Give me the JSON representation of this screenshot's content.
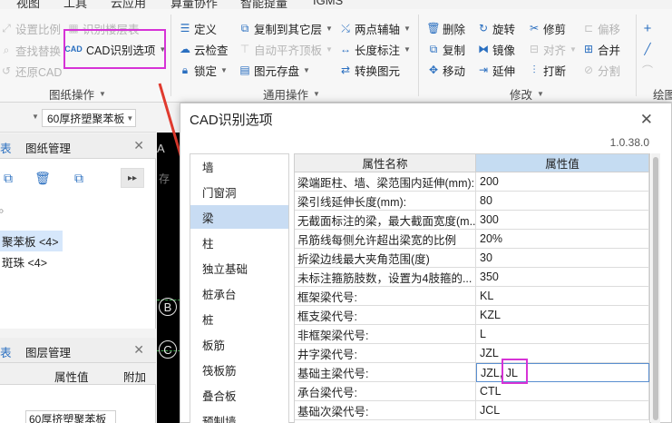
{
  "menubar": {
    "items": [
      "视图",
      "工具",
      "云应用",
      "算量协作",
      "智能提量",
      "IGMS"
    ]
  },
  "ribbon": {
    "drawing_ops": {
      "set_scale": "设置比例",
      "find_replace": "查找替换",
      "restore_cad": "还原CAD",
      "identify_floor_table": "识别楼层表",
      "cad_options": "CAD识别选项",
      "group_label": "图纸操作"
    },
    "common_ops": {
      "define": "定义",
      "cloud_check": "云检查",
      "lock": "锁定",
      "copy_to_floor": "复制到其它层",
      "auto_align": "自动平齐顶板",
      "element_save": "图元存盘",
      "two_point_axis": "两点辅轴",
      "length_dim": "长度标注",
      "convert_element": "转换图元",
      "group_label": "通用操作"
    },
    "modify_ops": {
      "delete": "删除",
      "copy": "复制",
      "move": "移动",
      "rotate": "旋转",
      "mirror": "镜像",
      "extend": "延伸",
      "trim": "修剪",
      "align": "对齐",
      "break": "打断",
      "offset": "偏移",
      "merge": "合并",
      "split": "分割",
      "group_label": "修改"
    },
    "draw_ops": {
      "group_label": "绘图"
    }
  },
  "left_panel": {
    "layer_select_value": "60厚挤塑聚苯板",
    "tabs_a": [
      "表",
      "图纸管理"
    ],
    "list_items": [
      "聚苯板 <4>",
      "斑珠 <4>"
    ],
    "tabs_b": [
      "表",
      "图层管理"
    ],
    "cols_b": [
      "属性值",
      "附加"
    ],
    "value_b": "60厚挤塑聚苯板"
  },
  "canvas": {
    "axis_labels": [
      "A",
      "B",
      "C"
    ],
    "side_text": "存"
  },
  "dialog": {
    "title": "CAD识别选项",
    "version": "1.0.38.0",
    "element_types": [
      "墙",
      "门窗洞",
      "梁",
      "柱",
      "独立基础",
      "桩承台",
      "桩",
      "板筋",
      "筏板筋",
      "叠合板",
      "预制墙"
    ],
    "selected_element": "梁",
    "grid_headers": {
      "name": "属性名称",
      "value": "属性值"
    },
    "rows": [
      {
        "name": "梁端距柱、墙、梁范围内延伸(mm):",
        "value": "200"
      },
      {
        "name": "梁引线延伸长度(mm):",
        "value": "80"
      },
      {
        "name": "无截面标注的梁，最大截面宽度(m...",
        "value": "300"
      },
      {
        "name": "吊筋线每侧允许超出梁宽的比例",
        "value": "20%"
      },
      {
        "name": "折梁边线最大夹角范围(度)",
        "value": "30"
      },
      {
        "name": "未标注箍筋肢数，设置为4肢箍的...",
        "value": "350"
      },
      {
        "name": "框架梁代号:",
        "value": "KL"
      },
      {
        "name": "框支梁代号:",
        "value": "KZL"
      },
      {
        "name": "非框架梁代号:",
        "value": "L"
      },
      {
        "name": "井字梁代号:",
        "value": "JZL"
      },
      {
        "name": "基础主梁代号:",
        "value": "JZL, JL"
      },
      {
        "name": "承台梁代号:",
        "value": "CTL"
      },
      {
        "name": "基础次梁代号:",
        "value": "JCL"
      }
    ],
    "editing_row_index": 10
  },
  "colors": {
    "highlight": "#d633d6",
    "arrow": "#e03a2e",
    "selected_bg": "#c8dcf3",
    "header_value_bg": "#c5dcf2"
  }
}
